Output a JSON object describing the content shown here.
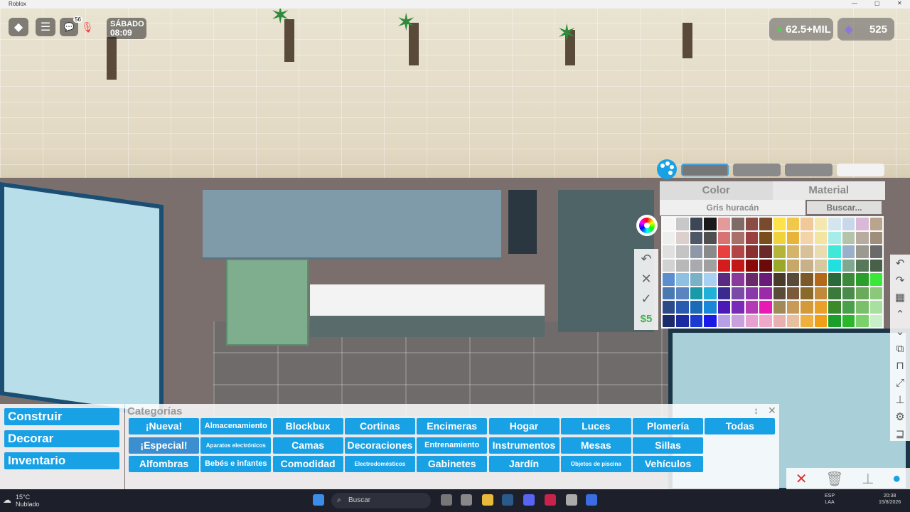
{
  "window": {
    "title": "Roblox"
  },
  "hud": {
    "notifications": "56",
    "day": "SÁBADO",
    "time": "08:09",
    "money": "62.5+MIL",
    "gems": "525"
  },
  "picker": {
    "modes": [
      "Color",
      "Material"
    ],
    "selected_color_name": "Gris huracán",
    "search_placeholder": "Buscar...",
    "price": "$5",
    "swatches": [
      "#f5f5f5",
      "#c8c8c8",
      "#3c4654",
      "#1a1a1a",
      "#e59a9a",
      "#7f6b66",
      "#8a4c45",
      "#7a4a2e",
      "#ffe24a",
      "#f2c84a",
      "#f0c89a",
      "#f5e7b0",
      "#d3e6ee",
      "#c9d8e8",
      "#d9b8d8",
      "#b9a48c",
      "#eeeeee",
      "#dcd0cc",
      "#4d5766",
      "#4f4f4f",
      "#d97272",
      "#a87068",
      "#9a4040",
      "#7a4e1a",
      "#f0d23a",
      "#e8b43a",
      "#f2d4a8",
      "#f3e4a0",
      "#a6ece8",
      "#b4c4aa",
      "#b8aca0",
      "#a08e7c",
      "#e0e0e0",
      "#c4c4c4",
      "#8e98a8",
      "#8a8a8a",
      "#e84040",
      "#b24646",
      "#8a3030",
      "#6a2a2a",
      "#b4b43a",
      "#d4b468",
      "#d8c098",
      "#e8dcb0",
      "#40e8d8",
      "#9ab0c8",
      "#9a9a90",
      "#6a6a6a",
      "#d2d2d2",
      "#b8b8b8",
      "#a8aab0",
      "#a0a0a0",
      "#d41c1c",
      "#c21818",
      "#8a0a0a",
      "#6a0a0a",
      "#9aa82a",
      "#c8a868",
      "#c8b088",
      "#d8c8a0",
      "#20e0e0",
      "#80a890",
      "#58785a",
      "#486048",
      "#5a8ed0",
      "#8ec0e0",
      "#7ab0c8",
      "#a8d0f0",
      "#5a2a82",
      "#8a3a9a",
      "#6a2a6a",
      "#6a1a7a",
      "#4a3a2a",
      "#5a4a3a",
      "#7a5a2a",
      "#b4681a",
      "#2a6a3a",
      "#3a8a3a",
      "#2aa02a",
      "#3ae83a",
      "#4a78b0",
      "#5a84c0",
      "#1a9aa8",
      "#20b0d8",
      "#3a2a90",
      "#7a4aa8",
      "#8a3aa8",
      "#9a2aa8",
      "#5a4a3a",
      "#7a5a3a",
      "#8a6a2a",
      "#c08a3a",
      "#3a7a3a",
      "#4a8a4a",
      "#6aaa5a",
      "#8ac87a",
      "#2a4a88",
      "#2a5ab0",
      "#1a6ab8",
      "#1a88d8",
      "#4a1ab8",
      "#7a2ab8",
      "#b43ab4",
      "#e81ab4",
      "#a08a5a",
      "#c89a5a",
      "#d49a3a",
      "#e8a028",
      "#3a8a2a",
      "#4aa04a",
      "#7ac06a",
      "#a8e0a0",
      "#1a2a6a",
      "#1a2aa0",
      "#1a3ad0",
      "#1a1ae8",
      "#b8a0e8",
      "#c8a0e0",
      "#e8a0d0",
      "#f0a8c8",
      "#e8b0b0",
      "#e8c0a0",
      "#f0b040",
      "#f0a018",
      "#1aa02a",
      "#2ab82a",
      "#7ad06a",
      "#c8f0c8"
    ]
  },
  "left_menu": [
    "Construir",
    "Decorar",
    "Inventario"
  ],
  "categories": {
    "title": "Categorías",
    "rows": [
      [
        "¡Nueva!",
        "Almacenamiento",
        "Blockbux",
        "Cortinas",
        "Encimeras",
        "Hogar",
        "Luces",
        "Plomería",
        "Todas"
      ],
      [
        "¡Especial!",
        "Aparatos electrónicos",
        "Camas",
        "Decoraciones",
        "Entrenamiento",
        "Instrumentos",
        "Mesas",
        "Sillas"
      ],
      [
        "Alfombras",
        "Bebés e infantes",
        "Comodidad",
        "Electrodomésticos",
        "Gabinetes",
        "Jardín",
        "Objetos de piscina",
        "Vehículos"
      ]
    ]
  },
  "taskbar": {
    "temperature": "15°C",
    "weather": "Nublado",
    "search": "Buscar",
    "lang": "ESP",
    "region": "LAA",
    "clock_time": "20:38",
    "clock_date": "15/8/2026"
  }
}
